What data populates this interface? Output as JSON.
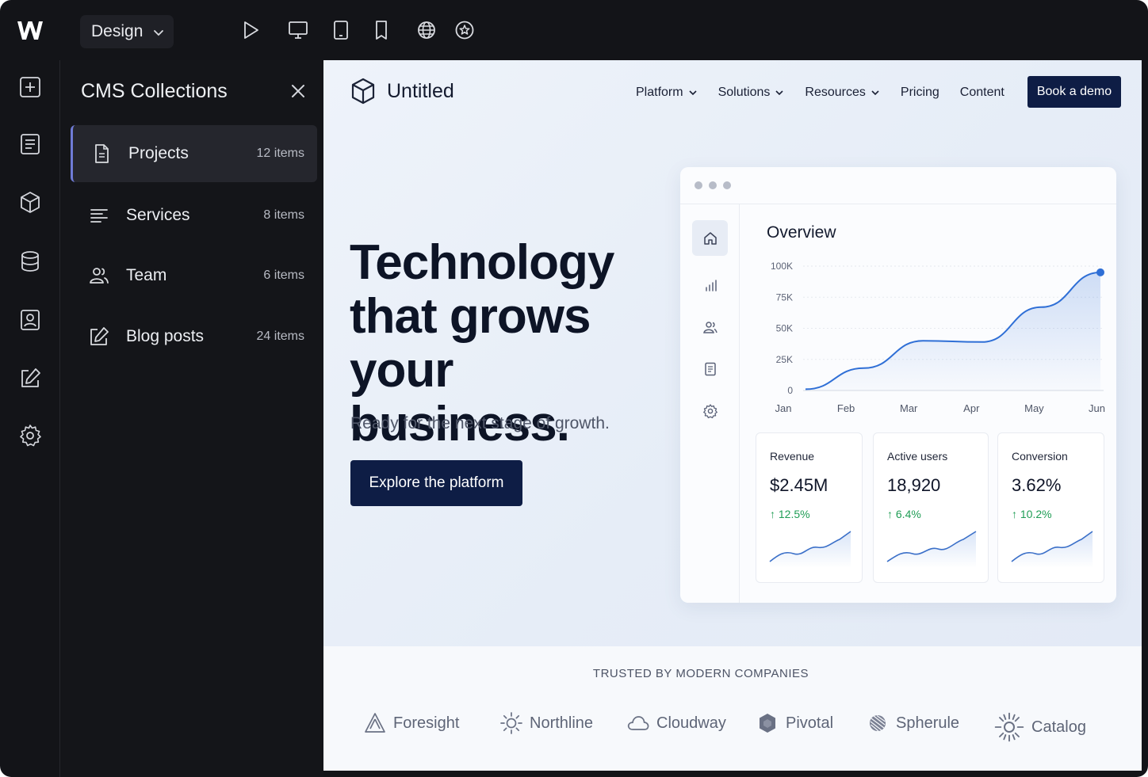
{
  "editor": {
    "mode": "Design"
  },
  "panel": {
    "title": "CMS Collections",
    "collections": [
      {
        "label": "Projects",
        "count": "12 items",
        "active": true
      },
      {
        "label": "Services",
        "count": "8 items"
      },
      {
        "label": "Team",
        "count": "6 items"
      },
      {
        "label": "Blog posts",
        "count": "24 items"
      }
    ]
  },
  "site": {
    "brand": "Untitled",
    "nav": [
      "Platform",
      "Solutions",
      "Resources",
      "Pricing",
      "Content"
    ],
    "cta_nav": "Book a demo",
    "hero_title": "Technology that grows your business.",
    "hero_subtitle": "Ready for the next stage of growth.",
    "hero_cta": "Explore the platform",
    "trusted_label": "TRUSTED BY MODERN COMPANIES",
    "logos": [
      "Foresight",
      "Northline",
      "Cloudway",
      "Pivotal",
      "Spherule",
      "Catalog"
    ]
  },
  "dashboard": {
    "title": "Overview",
    "kpis": [
      {
        "label": "Revenue",
        "value": "$2.45M",
        "delta": "↑ 12.5%"
      },
      {
        "label": "Active users",
        "value": "18,920",
        "delta": "↑ 6.4%"
      },
      {
        "label": "Conversion",
        "value": "3.62%",
        "delta": "↑ 10.2%"
      }
    ]
  },
  "chart_data": {
    "type": "area",
    "x": [
      "Jan",
      "Feb",
      "Mar",
      "Apr",
      "May",
      "Jun"
    ],
    "values": [
      1000,
      18000,
      40000,
      39000,
      67000,
      95000
    ],
    "y_ticks": [
      "0",
      "25K",
      "50K",
      "75K",
      "100K"
    ],
    "ylim": [
      0,
      100000
    ],
    "grid": true,
    "color": "#2f6fd6"
  },
  "colors": {
    "accent_dark": "#0e1d45",
    "editor_bg": "#131418",
    "active_indicator": "#6f7bd6",
    "positive": "#1f9d55"
  }
}
